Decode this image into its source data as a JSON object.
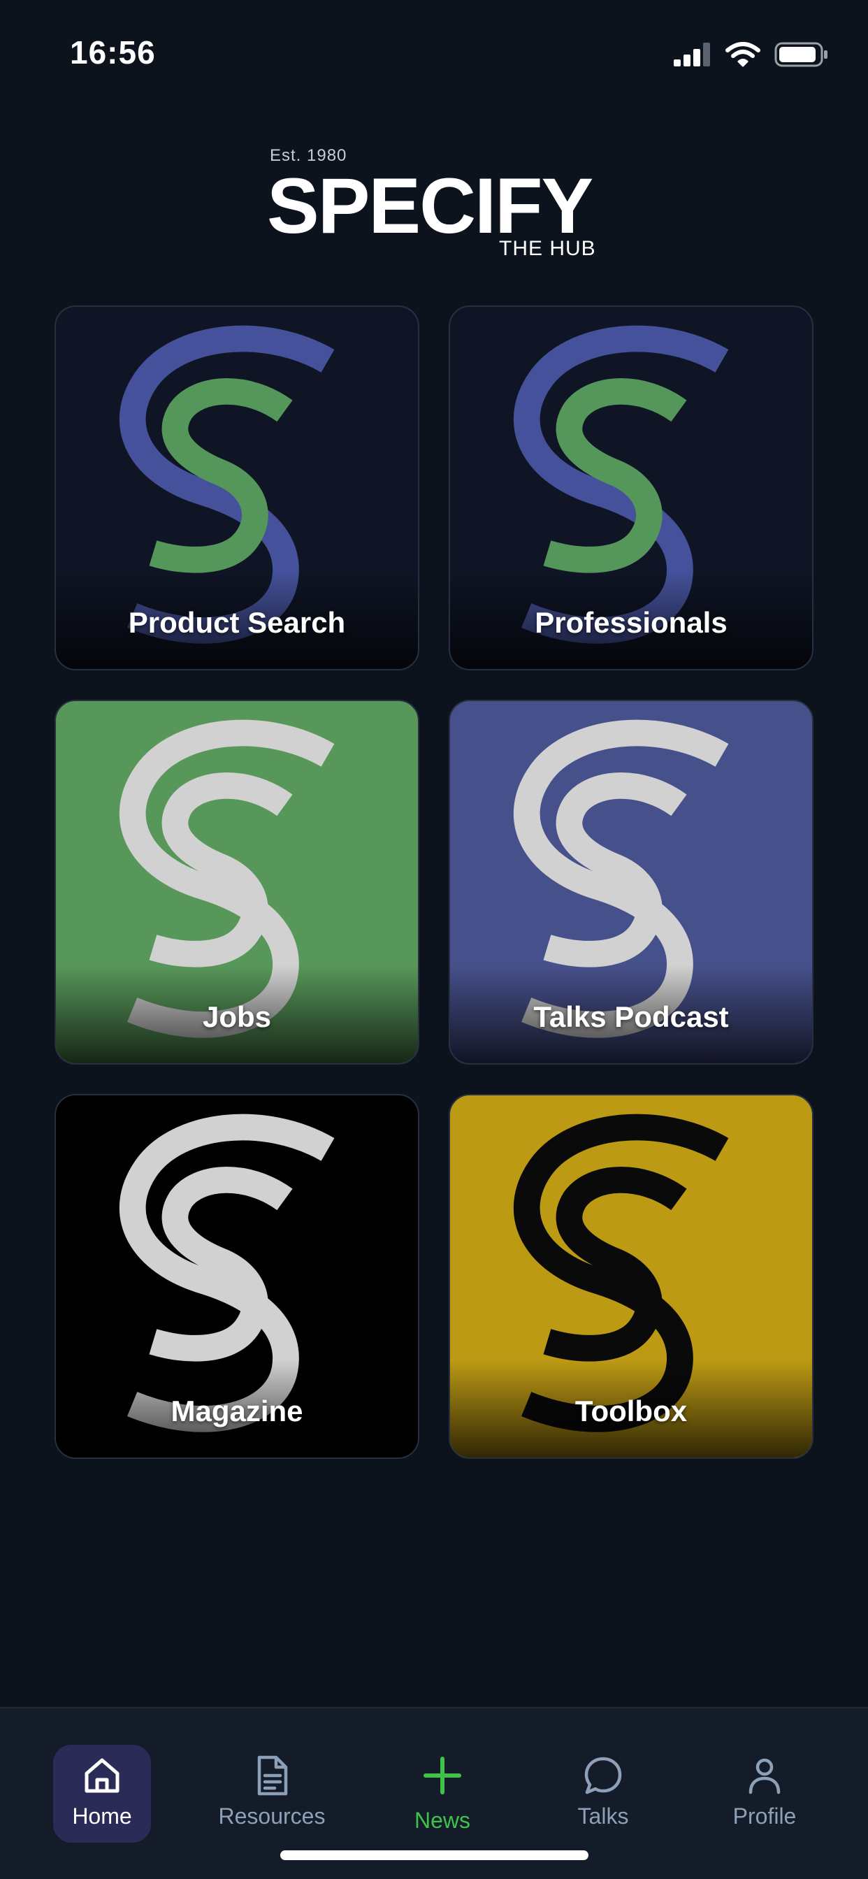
{
  "status_bar": {
    "time": "16:56"
  },
  "logo": {
    "est": "Est. 1980",
    "word": "SPECIFY",
    "sub": "THE HUB"
  },
  "tiles": [
    {
      "label": "Product Search",
      "bg": "#0f1525",
      "outer": "#45519a",
      "inner": "#55975a"
    },
    {
      "label": "Professionals",
      "bg": "#0f1525",
      "outer": "#45519a",
      "inner": "#55975a"
    },
    {
      "label": "Jobs",
      "bg": "#58975a",
      "outer": "#d1d1d1",
      "inner": "#d1d1d1"
    },
    {
      "label": "Talks Podcast",
      "bg": "#46508b",
      "outer": "#d1d1d1",
      "inner": "#d1d1d1"
    },
    {
      "label": "Magazine",
      "bg": "#000000",
      "outer": "#d1d1d1",
      "inner": "#d1d1d1"
    },
    {
      "label": "Toolbox",
      "bg": "#bd9a14",
      "outer": "#0a0a0a",
      "inner": "#0a0a0a"
    }
  ],
  "tab_bar": {
    "tabs": [
      {
        "label": "Home",
        "icon": "home-icon",
        "active": true
      },
      {
        "label": "Resources",
        "icon": "document-icon"
      },
      {
        "label": "News",
        "icon": "plus-icon"
      },
      {
        "label": "Talks",
        "icon": "chat-bubble-icon"
      },
      {
        "label": "Profile",
        "icon": "person-icon"
      }
    ]
  },
  "colors": {
    "background": "#0d131d",
    "tab_bar": "#141c29",
    "active_tab": "#2a2b57",
    "news_accent": "#3ec24a",
    "inactive_tab_text": "#8ea0b8"
  }
}
